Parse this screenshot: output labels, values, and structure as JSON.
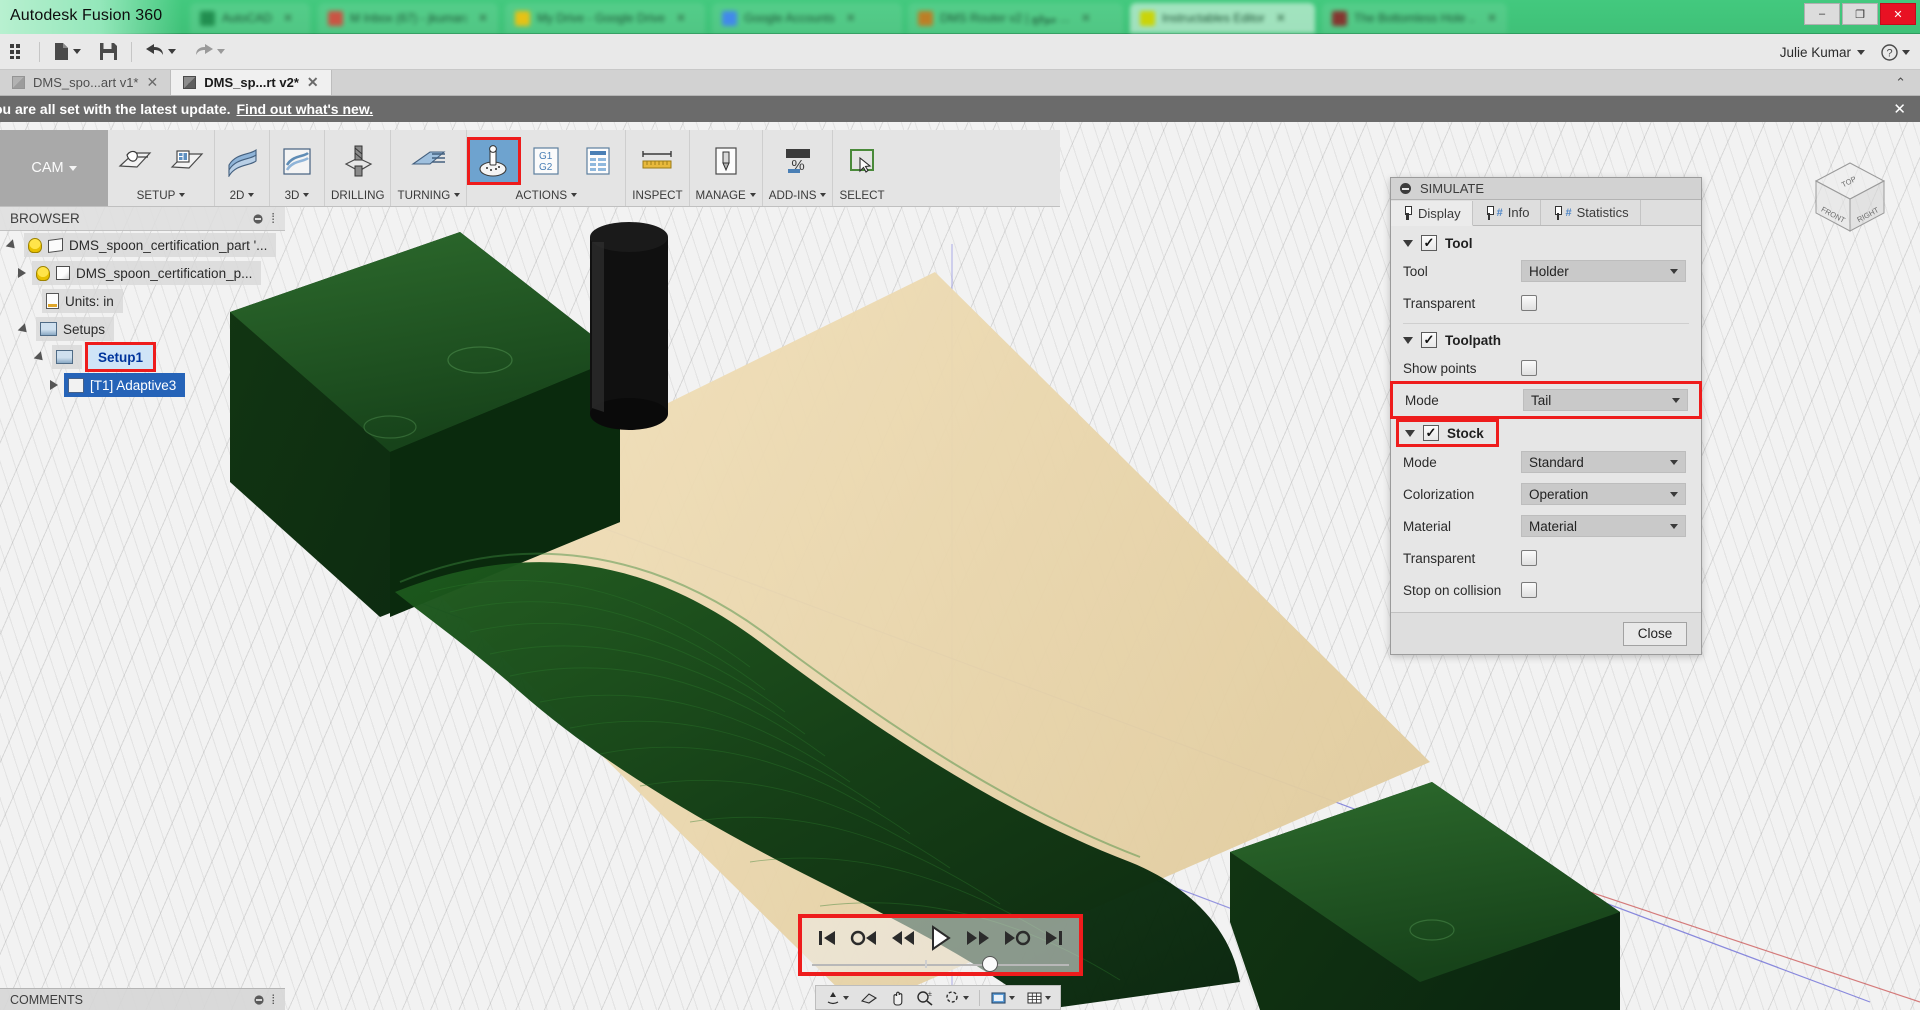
{
  "window": {
    "app_title": "Autodesk Fusion 360",
    "minimize": "–",
    "maximize": "❐",
    "close": "✕"
  },
  "browser_tabs": [
    {
      "title": "AutoCAD",
      "color": "#1f8a4c"
    },
    {
      "title": "M Inbox (67) - jkumar@au...",
      "color": "#d64b3f"
    },
    {
      "title": "My Drive - Google Drive",
      "color": "#f4c20d"
    },
    {
      "title": "Google Accounts",
      "color": "#4285f4"
    },
    {
      "title": "DMS Router v2 | موقع ...",
      "color": "#c8791f"
    },
    {
      "title": "Instructables Editor",
      "color": "#d6d600"
    },
    {
      "title": "The Bottomless Hole ...",
      "color": "#8b2a2a"
    }
  ],
  "quick_access": {
    "grid_label": "grid-menu",
    "new_label": "new-file",
    "save_label": "save",
    "undo_label": "undo",
    "redo_label": "redo",
    "user_name": "Julie Kumar",
    "help_label": "?"
  },
  "doc_tabs": [
    {
      "label": "DMS_spo...art v1*",
      "active": false
    },
    {
      "label": "DMS_sp...rt v2*",
      "active": true
    }
  ],
  "notification": {
    "text": "ou are all set with the latest update.",
    "link": "Find out what's new.",
    "close": "✕"
  },
  "ribbon": {
    "workspace": "CAM",
    "groups": [
      {
        "label": "SETUP",
        "has_caret": true,
        "buttons": [
          "setup-icon",
          "folder-setup-icon"
        ]
      },
      {
        "label": "2D",
        "has_caret": true,
        "buttons": [
          "2d-toolpath-icon"
        ]
      },
      {
        "label": "3D",
        "has_caret": true,
        "buttons": [
          "3d-toolpath-icon"
        ]
      },
      {
        "label": "DRILLING",
        "has_caret": false,
        "buttons": [
          "drilling-icon"
        ]
      },
      {
        "label": "TURNING",
        "has_caret": true,
        "buttons": [
          "turning-icon"
        ]
      },
      {
        "label": "ACTIONS",
        "has_caret": true,
        "buttons": [
          "simulate-icon",
          "post-process-icon",
          "setup-sheet-icon"
        ]
      },
      {
        "label": "INSPECT",
        "has_caret": false,
        "buttons": [
          "measure-icon"
        ]
      },
      {
        "label": "MANAGE",
        "has_caret": true,
        "buttons": [
          "tool-library-icon"
        ]
      },
      {
        "label": "ADD-INS",
        "has_caret": true,
        "buttons": [
          "addins-icon"
        ]
      },
      {
        "label": "SELECT",
        "has_caret": false,
        "buttons": [
          "select-icon"
        ]
      }
    ]
  },
  "browser_panel": {
    "header": "BROWSER",
    "tree": [
      {
        "label": "DMS_spoon_certification_part '...",
        "indent": 0,
        "expander": "down",
        "icons": [
          "bulb",
          "assembly"
        ]
      },
      {
        "label": "DMS_spoon_certification_p...",
        "indent": 1,
        "expander": "right",
        "icons": [
          "bulb",
          "body"
        ]
      },
      {
        "label": "Units: in",
        "indent": 2,
        "expander": "none",
        "icons": [
          "doc"
        ]
      },
      {
        "label": "Setups",
        "indent": 1,
        "expander": "down",
        "icons": [
          "setup"
        ]
      },
      {
        "label": "Setup1",
        "indent": 2,
        "expander": "down",
        "icons": [
          "setup"
        ],
        "state": "selected-light",
        "highlight": true
      },
      {
        "label": "[T1] Adaptive3",
        "indent": 3,
        "expander": "right",
        "icons": [
          "operation"
        ],
        "state": "selected-dark"
      }
    ],
    "comments_label": "COMMENTS"
  },
  "simulate_dialog": {
    "title": "SIMULATE",
    "tabs": [
      {
        "label": "Display",
        "active": true
      },
      {
        "label": "Info",
        "active": false
      },
      {
        "label": "Statistics",
        "active": false
      }
    ],
    "sections": [
      {
        "name": "Tool",
        "checked": true,
        "expanded": true,
        "fields": [
          {
            "label": "Tool",
            "type": "select",
            "value": "Holder"
          },
          {
            "label": "Transparent",
            "type": "checkbox",
            "value": false
          }
        ]
      },
      {
        "name": "Toolpath",
        "checked": true,
        "expanded": true,
        "fields": [
          {
            "label": "Show points",
            "type": "checkbox",
            "value": false
          },
          {
            "label": "Mode",
            "type": "select",
            "value": "Tail",
            "highlight": true
          }
        ]
      },
      {
        "name": "Stock",
        "checked": true,
        "expanded": true,
        "highlight": true,
        "fields": [
          {
            "label": "Mode",
            "type": "select",
            "value": "Standard"
          },
          {
            "label": "Colorization",
            "type": "select",
            "value": "Operation"
          },
          {
            "label": "Material",
            "type": "select",
            "value": "Material"
          },
          {
            "label": "Transparent",
            "type": "checkbox",
            "value": false
          },
          {
            "label": "Stop on collision",
            "type": "checkbox",
            "value": false
          }
        ]
      }
    ],
    "close_button": "Close"
  },
  "playback": {
    "buttons": [
      "skip-to-start-icon",
      "step-back-operation-icon",
      "rewind-icon",
      "play-icon",
      "fast-forward-icon",
      "step-forward-operation-icon",
      "skip-to-end-icon"
    ],
    "progress_percent": 66,
    "highlighted": true
  },
  "viewcube": {
    "front": "FRONT",
    "top": "TOP",
    "right": "RIGHT"
  },
  "navbar": {
    "items": [
      "orbit-icon",
      "look-at-icon",
      "pan-icon",
      "zoom-icon",
      "fit-icon",
      "display-settings-icon",
      "grid-snaps-icon"
    ]
  },
  "colors": {
    "accent_red": "#ee1c1c",
    "selection_blue": "#2563b8",
    "stock_green": "#1d5a1d",
    "material_tan": "#f0dcb4",
    "chrome_green": "#43c97e"
  }
}
